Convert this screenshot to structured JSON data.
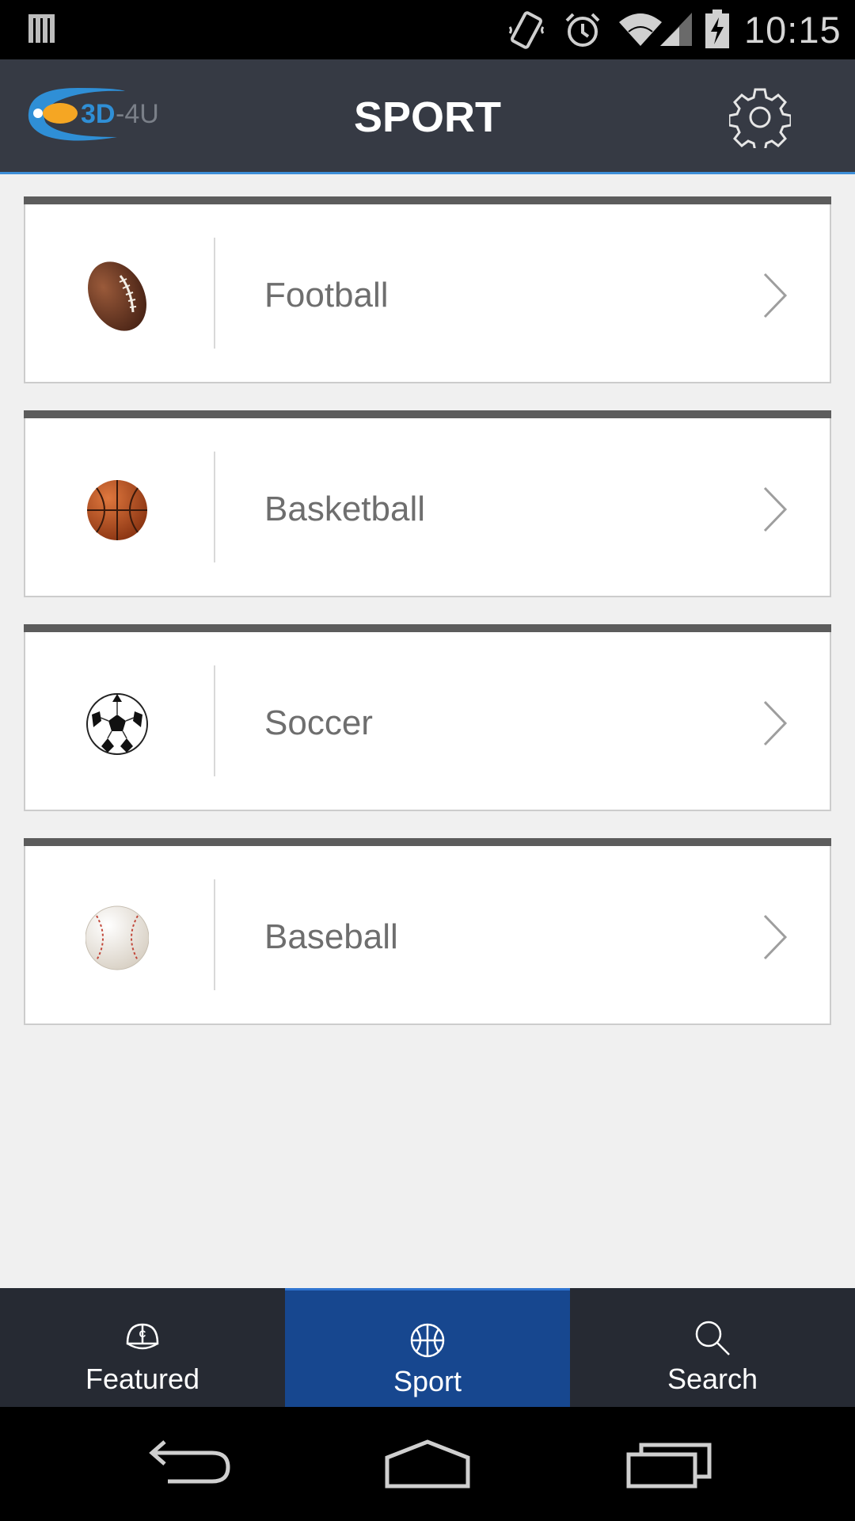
{
  "status_bar": {
    "time": "10:15",
    "icons": [
      "notification-icon",
      "vibrate-icon",
      "alarm-icon",
      "wifi-icon",
      "signal-icon",
      "battery-charging-icon"
    ]
  },
  "app_bar": {
    "logo_text": "3D-4U",
    "title": "SPORT",
    "settings_icon": "gear-icon"
  },
  "sports": [
    {
      "label": "Football",
      "icon": "football-icon"
    },
    {
      "label": "Basketball",
      "icon": "basketball-icon"
    },
    {
      "label": "Soccer",
      "icon": "soccer-ball-icon"
    },
    {
      "label": "Baseball",
      "icon": "baseball-icon"
    }
  ],
  "bottom_nav": {
    "tabs": [
      {
        "label": "Featured",
        "icon": "cap-icon",
        "active": false
      },
      {
        "label": "Sport",
        "icon": "basketball-icon",
        "active": true
      },
      {
        "label": "Search",
        "icon": "search-icon",
        "active": false
      }
    ]
  },
  "system_nav": {
    "buttons": [
      "back-icon",
      "home-icon",
      "recents-icon"
    ]
  },
  "colors": {
    "status_bar": "#000000",
    "app_bar": "#363a44",
    "accent_line": "#3d8fd8",
    "background": "#f0f0f0",
    "card_topbar": "#5c5c5c",
    "bottom_nav": "#262a33",
    "active_tab": "#17478f",
    "logo_orange": "#f5a623",
    "logo_blue": "#2f8fd6"
  }
}
